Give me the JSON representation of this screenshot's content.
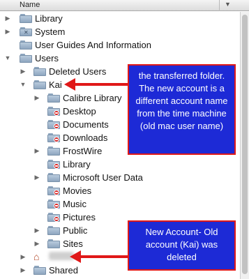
{
  "header": {
    "name_label": "Name",
    "sort_indicator": "▼"
  },
  "rows": [
    {
      "label": "Library",
      "expanded": false,
      "icon": "folder-icon"
    },
    {
      "label": "System",
      "expanded": false,
      "icon": "system-folder-icon"
    },
    {
      "label": "User Guides And Information",
      "expanded": null,
      "icon": "folder-icon"
    },
    {
      "label": "Users",
      "expanded": true,
      "icon": "folder-icon"
    },
    {
      "label": "Deleted Users",
      "expanded": false,
      "icon": "folder-icon"
    },
    {
      "label": "Kai",
      "expanded": true,
      "icon": "folder-icon"
    },
    {
      "label": "Calibre Library",
      "expanded": false,
      "icon": "folder-icon"
    },
    {
      "label": "Desktop",
      "expanded": null,
      "icon": "no-access-folder-icon"
    },
    {
      "label": "Documents",
      "expanded": null,
      "icon": "no-access-folder-icon"
    },
    {
      "label": "Downloads",
      "expanded": null,
      "icon": "no-access-folder-icon"
    },
    {
      "label": "FrostWire",
      "expanded": false,
      "icon": "folder-icon"
    },
    {
      "label": "Library",
      "expanded": null,
      "icon": "no-access-folder-icon"
    },
    {
      "label": "Microsoft User Data",
      "expanded": false,
      "icon": "folder-icon"
    },
    {
      "label": "Movies",
      "expanded": null,
      "icon": "no-access-folder-icon"
    },
    {
      "label": "Music",
      "expanded": null,
      "icon": "no-access-folder-icon"
    },
    {
      "label": "Pictures",
      "expanded": null,
      "icon": "no-access-folder-icon"
    },
    {
      "label": "Public",
      "expanded": false,
      "icon": "folder-icon"
    },
    {
      "label": "Sites",
      "expanded": false,
      "icon": "folder-icon"
    },
    {
      "label": "",
      "expanded": false,
      "icon": "home-icon"
    },
    {
      "label": "Shared",
      "expanded": false,
      "icon": "folder-icon"
    }
  ],
  "annotations": {
    "transferred": "the transferred folder. The new account is a different account name from the time machine (old mac user name)",
    "new_account": "New Account- Old account (Kai) was deleted"
  },
  "colors": {
    "annotation_bg": "#1d2ad6",
    "annotation_border": "#e01818",
    "arrow": "#e01818"
  }
}
